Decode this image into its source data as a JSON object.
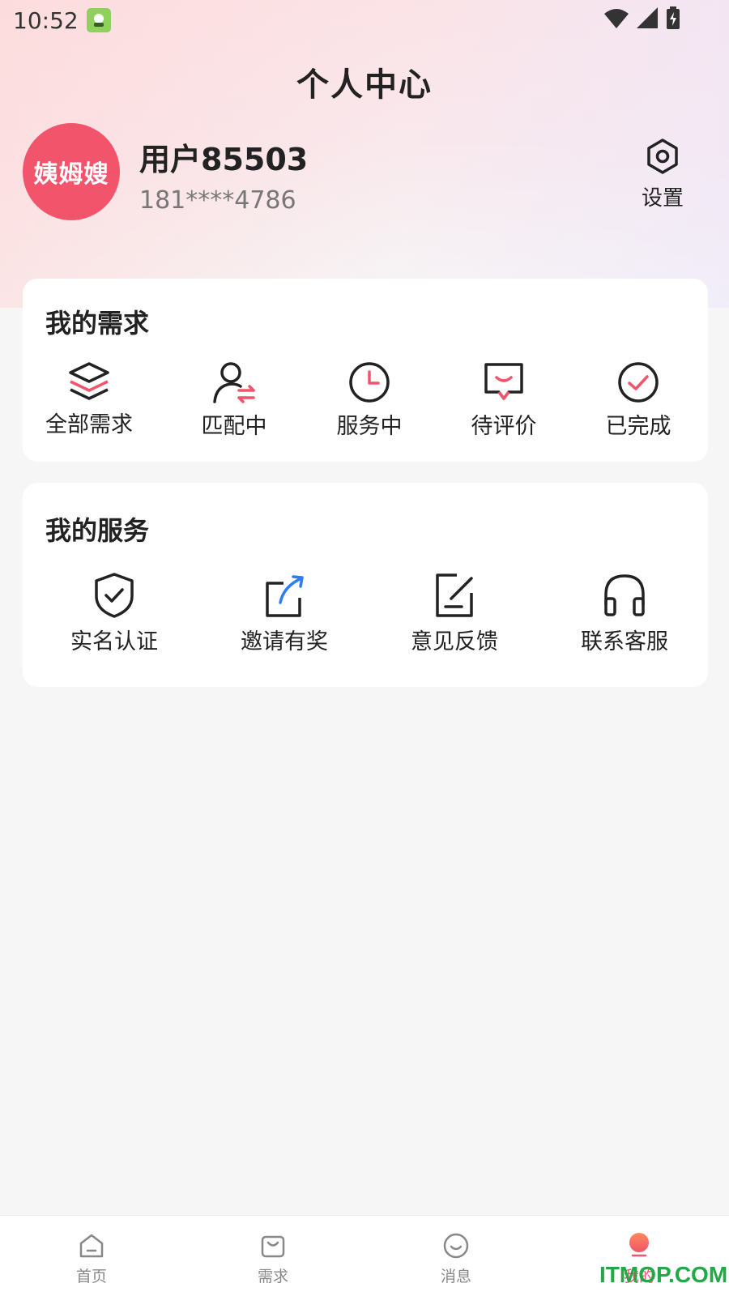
{
  "status": {
    "time": "10:52"
  },
  "header": {
    "title": "个人中心"
  },
  "profile": {
    "avatar_text": "姨姆嫂",
    "name": "用户85503",
    "phone": "181****4786",
    "settings_label": "设置"
  },
  "demands": {
    "title": "我的需求",
    "items": [
      {
        "label": "全部需求",
        "icon": "layers-icon"
      },
      {
        "label": "匹配中",
        "icon": "user-swap-icon"
      },
      {
        "label": "服务中",
        "icon": "clock-icon"
      },
      {
        "label": "待评价",
        "icon": "message-icon"
      },
      {
        "label": "已完成",
        "icon": "check-circle-icon"
      }
    ]
  },
  "services": {
    "title": "我的服务",
    "items": [
      {
        "label": "实名认证",
        "icon": "shield-check-icon"
      },
      {
        "label": "邀请有奖",
        "icon": "share-icon"
      },
      {
        "label": "意见反馈",
        "icon": "edit-note-icon"
      },
      {
        "label": "联系客服",
        "icon": "headphones-icon"
      }
    ]
  },
  "tabbar": {
    "items": [
      {
        "label": "首页",
        "icon": "home-icon"
      },
      {
        "label": "需求",
        "icon": "bag-icon"
      },
      {
        "label": "消息",
        "icon": "chat-icon"
      },
      {
        "label": "我的",
        "icon": "profile-icon"
      }
    ],
    "active": 3
  },
  "colors": {
    "accent": "#f2546b",
    "blue": "#2f7cf6"
  },
  "watermark": "ITMOP.COM"
}
